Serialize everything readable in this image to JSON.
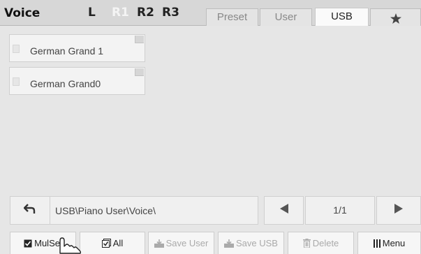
{
  "header": {
    "title": "Voice",
    "parts": [
      {
        "label": "L",
        "active": true
      },
      {
        "label": "R1",
        "active": false
      },
      {
        "label": "R2",
        "active": true
      },
      {
        "label": "R3",
        "active": true
      }
    ],
    "tabs": [
      {
        "label": "Preset",
        "selected": false
      },
      {
        "label": "User",
        "selected": false
      },
      {
        "label": "USB",
        "selected": true
      },
      {
        "label": "",
        "icon": "star-icon",
        "selected": false
      }
    ]
  },
  "voices": [
    {
      "name": "German Grand 1",
      "icon": "file-icon"
    },
    {
      "name": "German Grand0",
      "icon": "file-icon"
    }
  ],
  "path": {
    "back_icon": "back-arrow-icon",
    "text": "USB\\Piano User\\Voice\\"
  },
  "pager": {
    "prev_icon": "triangle-left-icon",
    "page": "1/1",
    "next_icon": "triangle-right-icon"
  },
  "toolbar": {
    "mulsel_label": "MulSel",
    "all_label": "All",
    "save_user_label": "Save User",
    "save_usb_label": "Save USB",
    "delete_label": "Delete",
    "menu_label": "Menu"
  },
  "colors": {
    "background": "#e6e6e6",
    "header": "#d7d7d7",
    "disabled_text": "#aaaaaa"
  }
}
